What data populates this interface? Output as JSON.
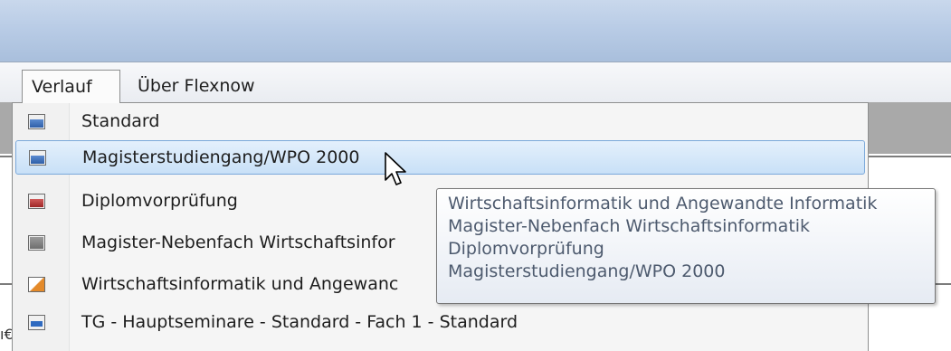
{
  "menubar": {
    "items": [
      {
        "label": "Verlauf",
        "open": true
      },
      {
        "label": "Über Flexnow",
        "open": false
      }
    ]
  },
  "dropdown": {
    "items": [
      {
        "label": "Standard",
        "icon": "blue-bar-icon",
        "selected": false
      },
      {
        "label": "Magisterstudiengang/WPO 2000",
        "icon": "blue-bar-icon",
        "selected": true
      },
      {
        "label": "Diplomvorprüfung",
        "icon": "red-bar-icon",
        "selected": false
      },
      {
        "label": "Magister-Nebenfach Wirtschaftsinfor",
        "icon": "gray-square-icon",
        "selected": false
      },
      {
        "label": "Wirtschaftsinformatik und Angewanc",
        "icon": "orange-triangle-icon",
        "selected": false
      },
      {
        "label": "TG - Hauptseminare - Standard - Fach 1 - Standard",
        "icon": "double-blue-icon",
        "selected": false
      }
    ]
  },
  "tooltip": {
    "lines": [
      "Wirtschaftsinformatik und Angewandte Informatik",
      "Magister-Nebenfach Wirtschaftsinformatik",
      "Diplomvorprüfung",
      "Magisterstudiengang/WPO 2000"
    ]
  },
  "colors": {
    "titlebar": "#b9cce6",
    "selection": "#c8e0f7",
    "selection_border": "#7aa8da",
    "tooltip_text": "#4d5a6e"
  }
}
